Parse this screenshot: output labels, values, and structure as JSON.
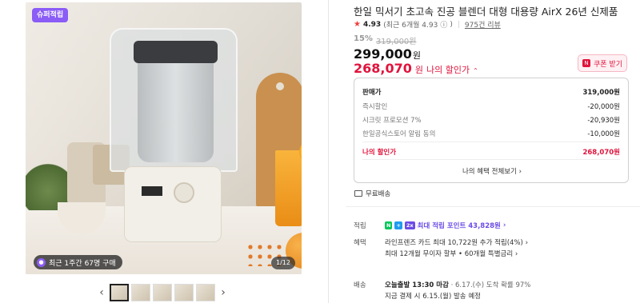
{
  "gallery": {
    "badge": "슈퍼적립",
    "recent_purchase": "최근 1주간 67명 구매",
    "page_indicator": "1/12",
    "thumbnail_count": 5
  },
  "product": {
    "title": "한일 믹서기 초고속 진공 블렌더 대형 대용량 AirX 26년 신제품",
    "rating_score": "4.93",
    "rating_recent": "(최근 6개월 4.93",
    "rating_recent_close": ")",
    "review_count": "975건 리뷰",
    "discount_rate": "15%",
    "original_price": "319,000원",
    "price": "299,000",
    "price_unit": "원",
    "my_price": "268,070",
    "my_price_unit": "원",
    "my_price_label": "나의 할인가"
  },
  "coupon": {
    "label": "쿠폰 받기"
  },
  "price_box": {
    "sale_label": "판매가",
    "sale_value": "319,000원",
    "rows": [
      {
        "label": "즉시할인",
        "value": "-20,000원"
      },
      {
        "label": "시크릿 프로모션 7%",
        "value": "-20,930원"
      },
      {
        "label": "한일공식스토어 알림 동의",
        "value": "-10,000원"
      }
    ],
    "mine_label": "나의 할인가",
    "mine_value": "268,070원",
    "all_benefits": "나의 혜택 전체보기"
  },
  "delivery": {
    "label": "무료배송"
  },
  "info": {
    "points_label": "적립",
    "points_badges": [
      "N",
      "+",
      "2x"
    ],
    "points_text": "최대 적립 포인트 43,828원",
    "benefit_label": "혜택",
    "benefit_lines": [
      "라인프렌즈 카드 최대 10,722원 추가 적립(4%)",
      "최대 12개월 무이자 할부 • 60개월 특별금리"
    ],
    "ship_label": "배송",
    "ship_bold": "오늘출발 13:30 마감",
    "ship_rest": " · 6.17.(수) 도착 확률 97%",
    "ship_line2": "지금 결제 시 6.15.(월) 발송 예정"
  }
}
